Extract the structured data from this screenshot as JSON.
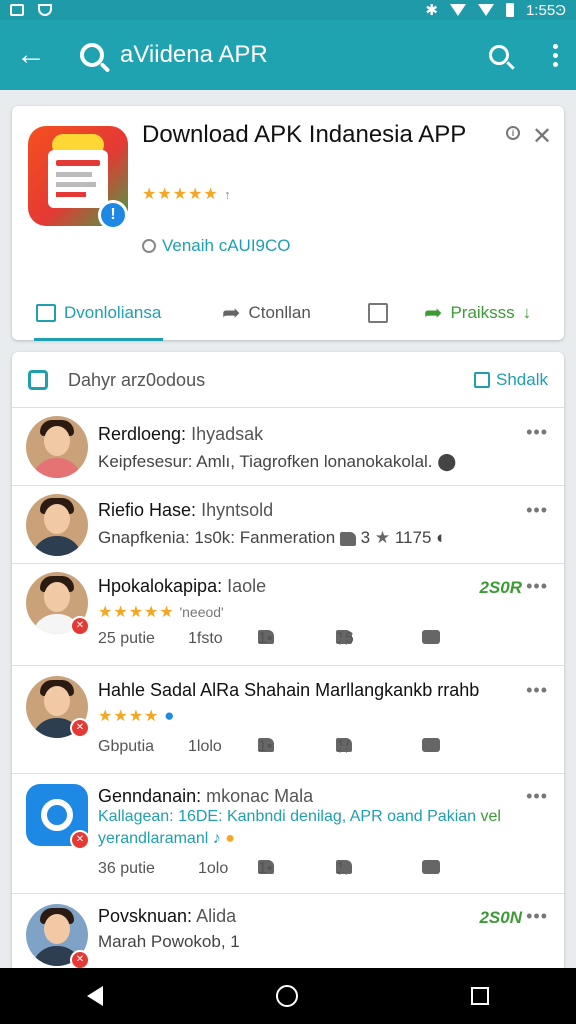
{
  "status": {
    "time": "1:55Ͽ"
  },
  "appbar": {
    "title": "aViidena APR"
  },
  "app": {
    "title": "Download APK Indanesia APP",
    "rating_stars": "★★★★★",
    "rating_extra": "↑",
    "version": "Venaih cAUI9CO",
    "badge": "!"
  },
  "tabs": [
    {
      "label": "Dvonloliansa"
    },
    {
      "label": "Ctonllan"
    },
    {
      "label": ""
    },
    {
      "label": "Praiksss"
    }
  ],
  "section": {
    "title": "Dahyr arz0odous",
    "action": "Shdalk"
  },
  "reviews": [
    {
      "name": "Rerdloeng:",
      "sub": "Ihyadsak",
      "line2": "Keipfesesur: Amlı, Tiagrofken lonanokakolal.",
      "avatar": "red"
    },
    {
      "name": "Riefio Hase:",
      "sub": "Ihyntsold",
      "line2": "Gnapfkenia: 1s0k: Fanmeration",
      "count_a": "3",
      "count_b": "1175",
      "avatar": "dark"
    },
    {
      "name": "Hpokalokapipa:",
      "sub": "Iaole",
      "stars": "★★★★★",
      "stars_tail": "'neeod'",
      "price": "2S0R",
      "likes": "25 putie",
      "col2": "1fsto",
      "col3": "1•",
      "col4": "16",
      "avatar": "white"
    },
    {
      "name": "Hahle Sadal AlRa Shahain Marllangkankb rrahb",
      "sub": "",
      "stars": "★★★★",
      "likes": "Gbputia",
      "col2": "1lolo",
      "col3": "1•",
      "col4": "1/",
      "avatar": "dark"
    },
    {
      "name": "Genndanain:",
      "sub": "mkonac Mala",
      "line2": "Kallagean: 16DE: Kanbndi denilag, APR oand Pakian",
      "line2_tail": "vel",
      "line3": "yerandlaramanl ♪",
      "likes": "36 putie",
      "col2": "1olo",
      "col3": "1•",
      "col4": "1",
      "avatar": "app"
    },
    {
      "name": "Povsknuan:",
      "sub": "Alida",
      "line2": "Marah Powokob, 1",
      "price": "2S0N",
      "avatar": "dark"
    }
  ],
  "colors": {
    "primary": "#1fa3b1",
    "accent_green": "#3d9b35",
    "star": "#f5a623"
  }
}
